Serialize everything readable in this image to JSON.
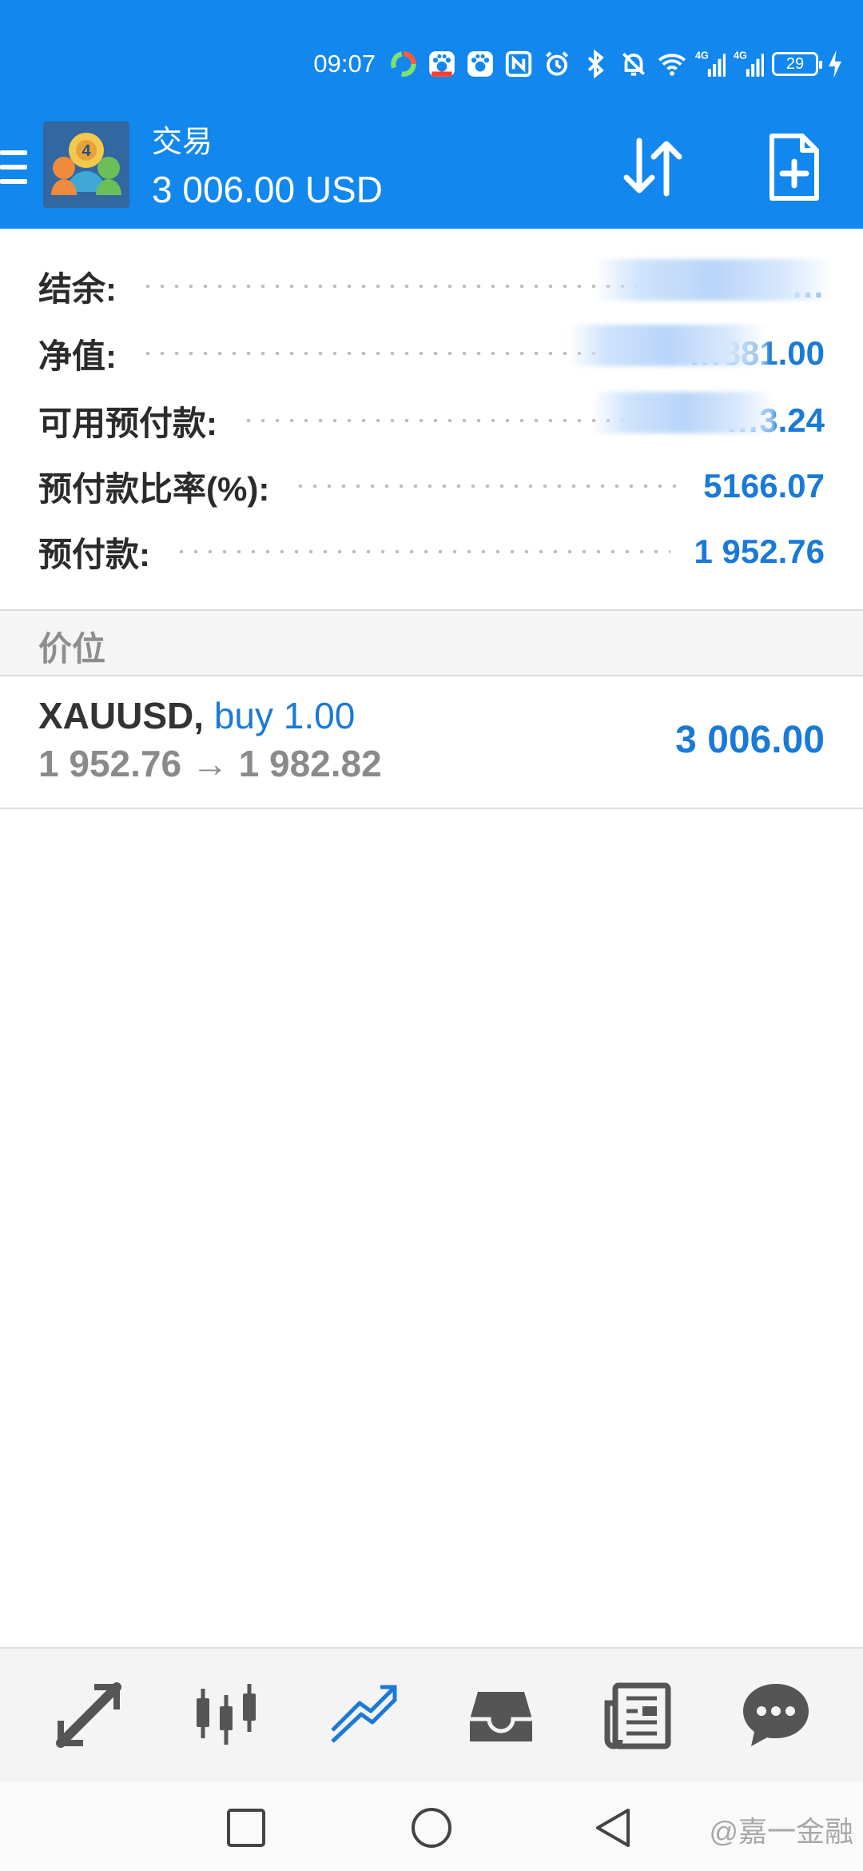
{
  "status_bar": {
    "time": "09:07",
    "battery": "29",
    "network_1": "4G",
    "network_2": "4G"
  },
  "header": {
    "title": "交易",
    "subtitle": "3 006.00 USD"
  },
  "summary": {
    "rows": [
      {
        "label": "结余:",
        "value": "…",
        "redacted": true
      },
      {
        "label": "净值:",
        "value": "…881.00",
        "redacted": true
      },
      {
        "label": "可用预付款:",
        "value": "…3.24",
        "redacted": true
      },
      {
        "label": "预付款比率(%):",
        "value": "5166.07",
        "redacted": false
      },
      {
        "label": "预付款:",
        "value": "1 952.76",
        "redacted": false
      }
    ]
  },
  "section": {
    "title": "价位"
  },
  "position": {
    "symbol": "XAUUSD,",
    "type": "buy 1.00",
    "prices": "1 952.76 → 1 982.82",
    "profit": "3 006.00"
  },
  "bottom_nav": {
    "items": [
      {
        "name": "quotes-icon",
        "active": false
      },
      {
        "name": "chart-icon",
        "active": false
      },
      {
        "name": "trade-icon",
        "active": true
      },
      {
        "name": "history-icon",
        "active": false
      },
      {
        "name": "news-icon",
        "active": false
      },
      {
        "name": "chat-icon",
        "active": false
      }
    ]
  },
  "watermark": "@嘉一金融",
  "colors": {
    "primary": "#1287ee",
    "value_blue": "#1a7ad6",
    "label": "#2b2b2b",
    "muted": "#8a8a8a"
  }
}
